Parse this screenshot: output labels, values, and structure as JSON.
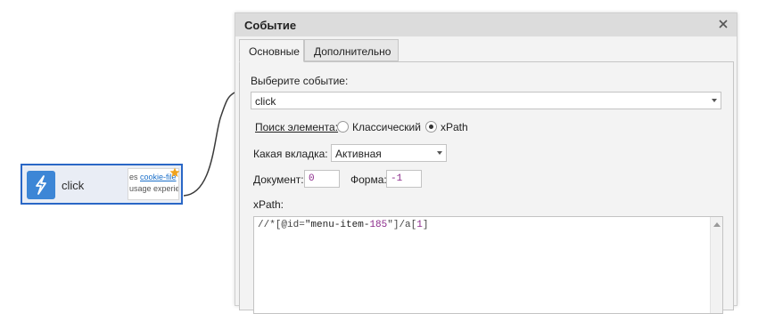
{
  "node": {
    "label": "click",
    "thumb_line1_prefix": "es ",
    "thumb_line1_link": "cookie-file",
    "thumb_line2": "usage experie",
    "icon": "lightning-icon",
    "star_icon": "star-icon",
    "accent": "#3d86d6",
    "border": "#2a67c6"
  },
  "dialog": {
    "title": "Событие",
    "close_icon": "close-icon",
    "tabs": [
      {
        "label": "Основные",
        "active": true
      },
      {
        "label": "Дополнительно",
        "active": false
      }
    ],
    "event_label": "Выберите событие:",
    "event_value": "click",
    "search_label": "Поиск элемента:",
    "radio_classic": "Классический",
    "radio_xpath": "xPath",
    "selected_search": "xPath",
    "tab_label": "Какая вкладка:",
    "tab_value": "Активная",
    "document_label": "Документ:",
    "document_value": "0",
    "frame_label": "Форма:",
    "frame_value": "-1",
    "xpath_label": "xPath:",
    "xpath_value": {
      "part1": "//*[@id=",
      "part2": "\"menu-item-",
      "part3": "185",
      "part4": "\"]/a[",
      "part5": "1",
      "part6": "]"
    }
  }
}
